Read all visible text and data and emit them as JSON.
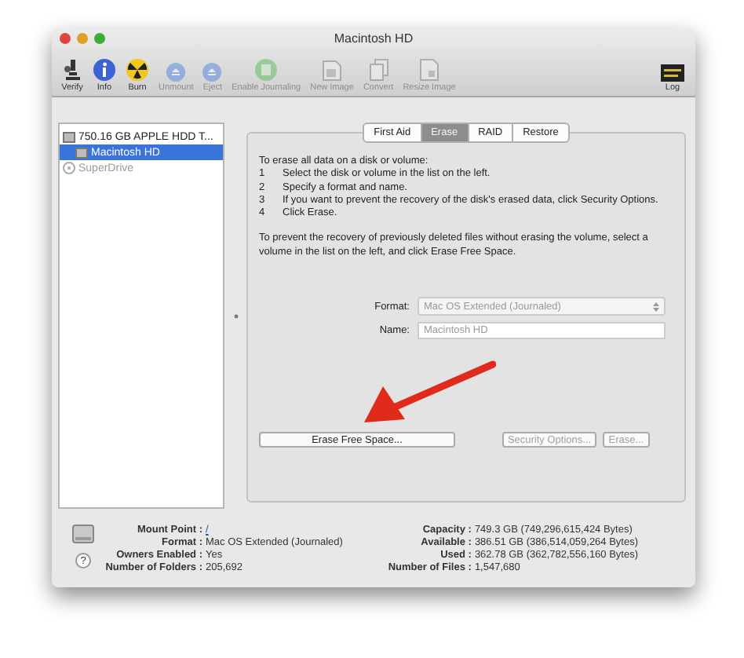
{
  "window": {
    "title": "Macintosh HD"
  },
  "toolbar": [
    {
      "label": "Verify",
      "disabled": false
    },
    {
      "label": "Info",
      "disabled": false
    },
    {
      "label": "Burn",
      "disabled": false
    },
    {
      "label": "Unmount",
      "disabled": true
    },
    {
      "label": "Eject",
      "disabled": true
    },
    {
      "label": "Enable Journaling",
      "disabled": true
    },
    {
      "label": "New Image",
      "disabled": true
    },
    {
      "label": "Convert",
      "disabled": true
    },
    {
      "label": "Resize Image",
      "disabled": true
    }
  ],
  "log": {
    "label": "Log"
  },
  "sidebar": {
    "items": [
      {
        "label": "750.16 GB APPLE HDD T...",
        "selected": false,
        "disabled": false,
        "children": [
          {
            "label": "Macintosh HD",
            "selected": true,
            "disabled": false
          }
        ]
      },
      {
        "label": "SuperDrive",
        "selected": false,
        "disabled": true
      }
    ]
  },
  "tabs": [
    {
      "label": "First Aid",
      "selected": false
    },
    {
      "label": "Erase",
      "selected": true
    },
    {
      "label": "RAID",
      "selected": false
    },
    {
      "label": "Restore",
      "selected": false
    }
  ],
  "instructions": {
    "intro": "To erase all data on a disk or volume:",
    "steps": [
      {
        "num": "1",
        "text": "Select the disk or volume in the list on the left."
      },
      {
        "num": "2",
        "text": "Specify a format and name."
      },
      {
        "num": "3",
        "text": "If you want to prevent the recovery of the disk's erased data, click Security Options."
      },
      {
        "num": "4",
        "text": "Click Erase."
      }
    ],
    "note": "To prevent the recovery of previously deleted files without erasing the volume, select a volume in the list on the left, and click Erase Free Space."
  },
  "format": {
    "label": "Format:",
    "value": "Mac OS Extended (Journaled)",
    "disabled": true
  },
  "name": {
    "label": "Name:",
    "value": "Macintosh HD",
    "disabled": true
  },
  "buttons": [
    {
      "label": "Erase Free Space...",
      "disabled": false
    },
    {
      "label": "Security Options...",
      "disabled": true
    },
    {
      "label": "Erase...",
      "disabled": true
    }
  ],
  "info_left": [
    {
      "label": "Mount Point :",
      "value": "/",
      "link": true
    },
    {
      "label": "Format :",
      "value": "Mac OS Extended (Journaled)"
    },
    {
      "label": "Owners Enabled :",
      "value": "Yes"
    },
    {
      "label": "Number of Folders :",
      "value": "205,692"
    }
  ],
  "info_right": [
    {
      "label": "Capacity :",
      "value": "749.3 GB (749,296,615,424 Bytes)"
    },
    {
      "label": "Available :",
      "value": "386.51 GB (386,514,059,264 Bytes)"
    },
    {
      "label": "Used :",
      "value": "362.78 GB (362,782,556,160 Bytes)"
    },
    {
      "label": "Number of Files :",
      "value": "1,547,680"
    }
  ],
  "help": {
    "label": "?"
  }
}
